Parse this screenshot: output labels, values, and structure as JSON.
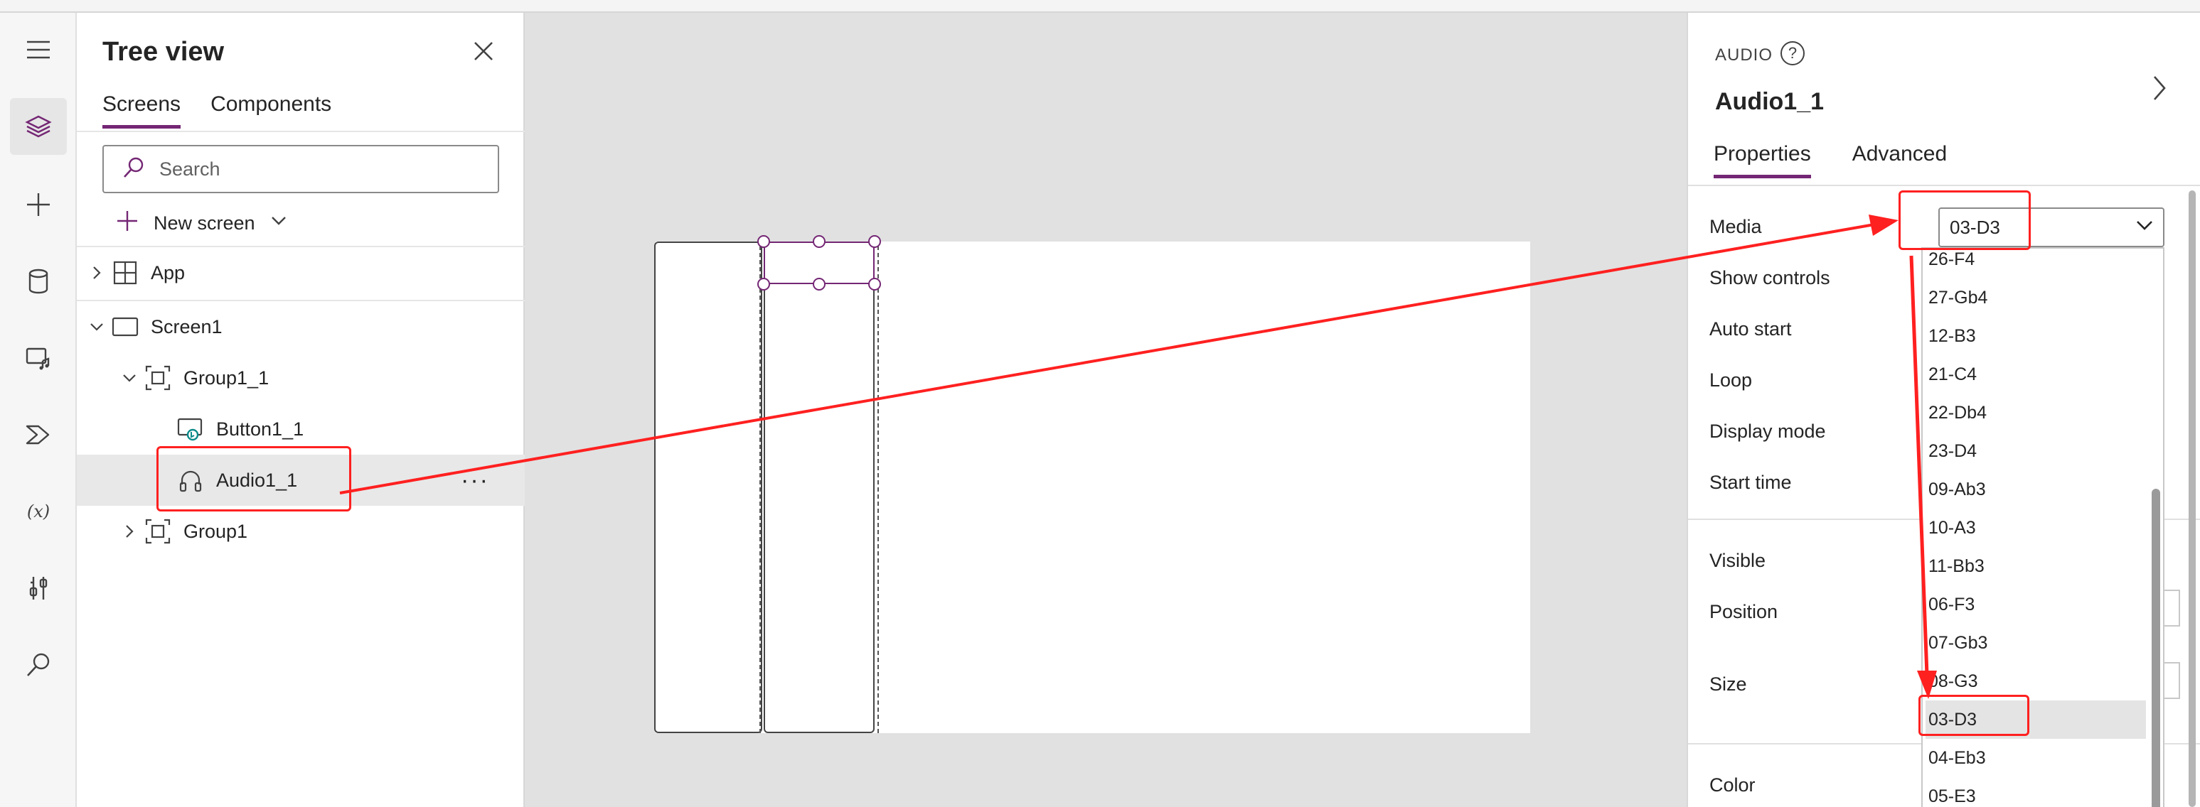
{
  "tree_panel": {
    "title": "Tree view",
    "tabs": [
      {
        "label": "Screens",
        "active": true
      },
      {
        "label": "Components",
        "active": false
      }
    ],
    "search_placeholder": "Search",
    "new_screen_label": "New screen",
    "nodes": {
      "app": "App",
      "screen1": "Screen1",
      "group1_1": "Group1_1",
      "button1_1": "Button1_1",
      "audio1_1": "Audio1_1",
      "group1": "Group1"
    },
    "more_label": "···"
  },
  "properties_panel": {
    "control_type": "AUDIO",
    "control_name": "Audio1_1",
    "tabs": [
      {
        "label": "Properties",
        "active": true
      },
      {
        "label": "Advanced",
        "active": false
      }
    ],
    "labels": {
      "media": "Media",
      "show_controls": "Show controls",
      "auto_start": "Auto start",
      "loop": "Loop",
      "display_mode": "Display mode",
      "start_time": "Start time",
      "visible": "Visible",
      "position": "Position",
      "size": "Size",
      "color": "Color"
    },
    "media_value": "03-D3",
    "media_options": [
      "26-F4",
      "27-Gb4",
      "12-B3",
      "21-C4",
      "22-Db4",
      "23-D4",
      "09-Ab3",
      "10-A3",
      "11-Bb3",
      "06-F3",
      "07-Gb3",
      "08-G3",
      "03-D3",
      "04-Eb3",
      "05-E3"
    ],
    "selected_option": "03-D3"
  },
  "colors": {
    "accent": "#742774",
    "annotation": "#ff2020",
    "canvas_bg": "#e1e1e1"
  },
  "icons": {
    "rail": [
      "hamburger-icon",
      "layers-icon",
      "plus-icon",
      "database-icon",
      "media-icon",
      "power-automate-icon",
      "variables-icon",
      "tools-icon",
      "search-icon"
    ]
  }
}
